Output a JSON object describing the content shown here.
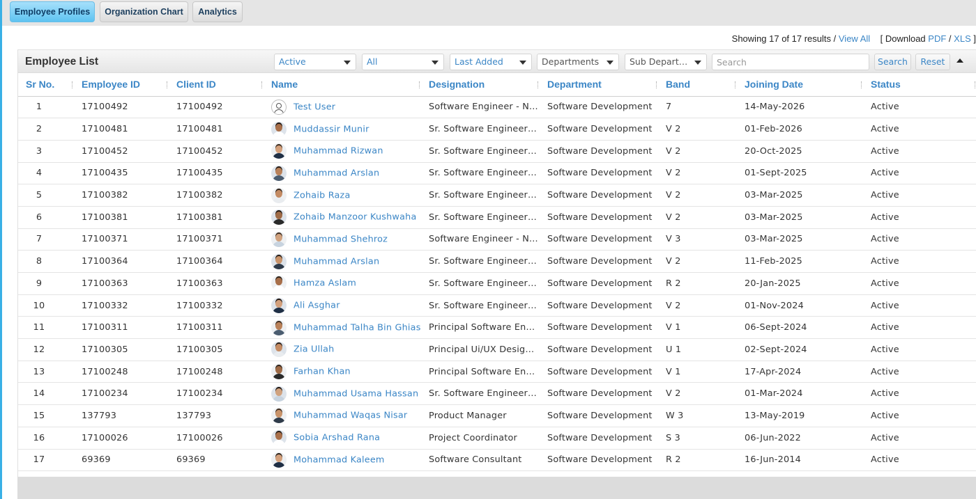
{
  "tabs": [
    {
      "label": "Employee Profiles",
      "active": true
    },
    {
      "label": "Organization Chart",
      "active": false
    },
    {
      "label": "Analytics",
      "active": false
    }
  ],
  "summary": {
    "showing": "Showing 17 of 17 results /",
    "view_all": "View All",
    "download_open": "[ Download",
    "pdf": "PDF",
    "slash": "/",
    "xls": "XLS",
    "download_close": "]"
  },
  "panel": {
    "title": "Employee List",
    "filters": {
      "status": "Active",
      "type": "All",
      "sort": "Last Added",
      "department": "Departments",
      "sub_department": "Sub Departments"
    },
    "search_placeholder": "Search",
    "search_button": "Search",
    "reset_button": "Reset"
  },
  "columns": [
    "Sr No.",
    "Employee ID",
    "Client ID",
    "Name",
    "Designation",
    "Department",
    "Band",
    "Joining Date",
    "Status"
  ],
  "rows": [
    {
      "sr": "1",
      "emp_id": "17100492",
      "client_id": "17100492",
      "name": "Test User",
      "designation": "Software Engineer - N...",
      "department": "Software Development",
      "band": "7",
      "joining": "14-May-2026",
      "status": "Active",
      "avatar": "placeholder"
    },
    {
      "sr": "2",
      "emp_id": "17100481",
      "client_id": "17100481",
      "name": "Muddassir Munir",
      "designation": "Sr. Software Engineer ...",
      "department": "Software Development",
      "band": "V 2",
      "joining": "01-Feb-2026",
      "status": "Active",
      "avatar": "photo"
    },
    {
      "sr": "3",
      "emp_id": "17100452",
      "client_id": "17100452",
      "name": "Muhammad Rizwan",
      "designation": "Sr. Software Engineer ...",
      "department": "Software Development",
      "band": "V 2",
      "joining": "20-Oct-2025",
      "status": "Active",
      "avatar": "photo"
    },
    {
      "sr": "4",
      "emp_id": "17100435",
      "client_id": "17100435",
      "name": "Muhammad Arslan",
      "designation": "Sr. Software Engineer ...",
      "department": "Software Development",
      "band": "V 2",
      "joining": "01-Sept-2025",
      "status": "Active",
      "avatar": "photo"
    },
    {
      "sr": "5",
      "emp_id": "17100382",
      "client_id": "17100382",
      "name": "Zohaib Raza",
      "designation": "Sr. Software Engineer ...",
      "department": "Software Development",
      "band": "V 2",
      "joining": "03-Mar-2025",
      "status": "Active",
      "avatar": "photo"
    },
    {
      "sr": "6",
      "emp_id": "17100381",
      "client_id": "17100381",
      "name": "Zohaib Manzoor Kushwaha",
      "designation": "Sr. Software Engineer ...",
      "department": "Software Development",
      "band": "V 2",
      "joining": "03-Mar-2025",
      "status": "Active",
      "avatar": "photo"
    },
    {
      "sr": "7",
      "emp_id": "17100371",
      "client_id": "17100371",
      "name": "Muhammad Shehroz",
      "designation": "Software Engineer - N...",
      "department": "Software Development",
      "band": "V 3",
      "joining": "03-Mar-2025",
      "status": "Active",
      "avatar": "photo"
    },
    {
      "sr": "8",
      "emp_id": "17100364",
      "client_id": "17100364",
      "name": "Muhammad Arslan",
      "designation": "Sr. Software Engineer ...",
      "department": "Software Development",
      "band": "V 2",
      "joining": "11-Feb-2025",
      "status": "Active",
      "avatar": "photo"
    },
    {
      "sr": "9",
      "emp_id": "17100363",
      "client_id": "17100363",
      "name": "Hamza Aslam",
      "designation": "Sr. Software Engineer ...",
      "department": "Software Development",
      "band": "R 2",
      "joining": "20-Jan-2025",
      "status": "Active",
      "avatar": "photo"
    },
    {
      "sr": "10",
      "emp_id": "17100332",
      "client_id": "17100332",
      "name": "Ali Asghar",
      "designation": "Sr. Software Engineer ...",
      "department": "Software Development",
      "band": "V 2",
      "joining": "01-Nov-2024",
      "status": "Active",
      "avatar": "photo"
    },
    {
      "sr": "11",
      "emp_id": "17100311",
      "client_id": "17100311",
      "name": "Muhammad Talha Bin Ghias",
      "designation": "Principal Software En...",
      "department": "Software Development",
      "band": "V 1",
      "joining": "06-Sept-2024",
      "status": "Active",
      "avatar": "photo"
    },
    {
      "sr": "12",
      "emp_id": "17100305",
      "client_id": "17100305",
      "name": "Zia Ullah",
      "designation": "Principal Ui/UX Design...",
      "department": "Software Development",
      "band": "U 1",
      "joining": "02-Sept-2024",
      "status": "Active",
      "avatar": "photo"
    },
    {
      "sr": "13",
      "emp_id": "17100248",
      "client_id": "17100248",
      "name": "Farhan Khan",
      "designation": "Principal Software En...",
      "department": "Software Development",
      "band": "V 1",
      "joining": "17-Apr-2024",
      "status": "Active",
      "avatar": "photo"
    },
    {
      "sr": "14",
      "emp_id": "17100234",
      "client_id": "17100234",
      "name": "Muhammad Usama Hassan",
      "designation": "Sr. Software Engineer ...",
      "department": "Software Development",
      "band": "V 2",
      "joining": "01-Mar-2024",
      "status": "Active",
      "avatar": "photo"
    },
    {
      "sr": "15",
      "emp_id": "137793",
      "client_id": "137793",
      "name": "Muhammad Waqas Nisar",
      "designation": "Product Manager",
      "department": "Software Development",
      "band": "W 3",
      "joining": "13-May-2019",
      "status": "Active",
      "avatar": "photo"
    },
    {
      "sr": "16",
      "emp_id": "17100026",
      "client_id": "17100026",
      "name": "Sobia Arshad Rana",
      "designation": "Project Coordinator",
      "department": "Software Development",
      "band": "S 3",
      "joining": "06-Jun-2022",
      "status": "Active",
      "avatar": "photo"
    },
    {
      "sr": "17",
      "emp_id": "69369",
      "client_id": "69369",
      "name": "Mohammad Kaleem",
      "designation": "Software Consultant",
      "department": "Software Development",
      "band": "R 2",
      "joining": "16-Jun-2014",
      "status": "Active",
      "avatar": "photo"
    }
  ],
  "colors": {
    "accent": "#3b86c6",
    "tab_active": "#5ec3f1",
    "header_bg": "#e6e6e6"
  }
}
